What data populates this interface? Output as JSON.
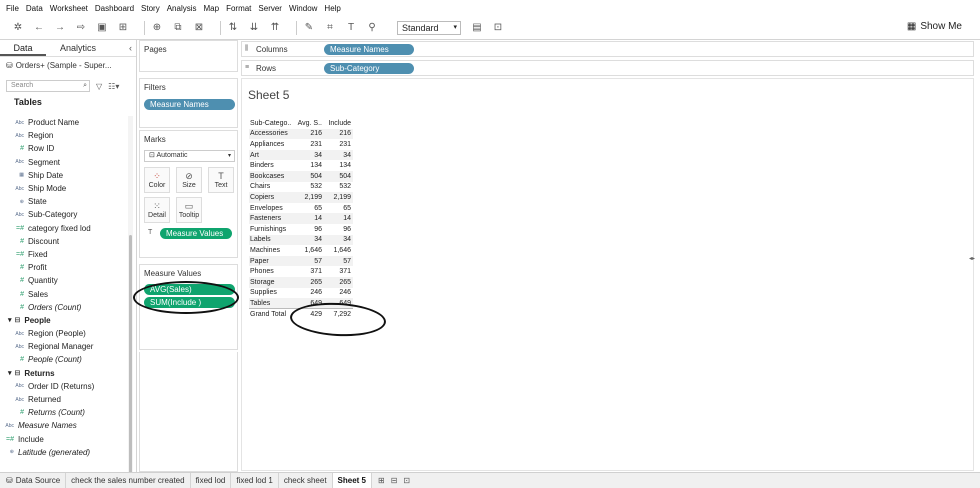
{
  "menu": [
    "File",
    "Data",
    "Worksheet",
    "Dashboard",
    "Story",
    "Analysis",
    "Map",
    "Format",
    "Server",
    "Window",
    "Help"
  ],
  "toolbar": {
    "fit_select": "Standard",
    "show_me": "Show Me"
  },
  "data_pane": {
    "tab_data": "Data",
    "tab_analytics": "Analytics",
    "datasource": "Orders+ (Sample - Super...",
    "search_placeholder": "Search",
    "tables_header": "Tables",
    "fields": [
      {
        "label": "Product Name",
        "type": "Abc",
        "kind": "dim",
        "italic": false
      },
      {
        "label": "Region",
        "type": "Abc",
        "kind": "dim",
        "italic": false
      },
      {
        "label": "Row ID",
        "type": "#",
        "kind": "dim",
        "italic": false
      },
      {
        "label": "Segment",
        "type": "Abc",
        "kind": "dim",
        "italic": false
      },
      {
        "label": "Ship Date",
        "type": "date",
        "kind": "dim",
        "italic": false
      },
      {
        "label": "Ship Mode",
        "type": "Abc",
        "kind": "dim",
        "italic": false
      },
      {
        "label": "State",
        "type": "geo",
        "kind": "dim",
        "italic": false
      },
      {
        "label": "Sub-Category",
        "type": "Abc",
        "kind": "dim",
        "italic": false
      },
      {
        "label": "category fixed lod",
        "type": "=#",
        "kind": "measure",
        "italic": false
      },
      {
        "label": "Discount",
        "type": "#",
        "kind": "measure",
        "italic": false
      },
      {
        "label": "Fixed",
        "type": "=#",
        "kind": "measure",
        "italic": false
      },
      {
        "label": "Profit",
        "type": "#",
        "kind": "measure",
        "italic": false
      },
      {
        "label": "Quantity",
        "type": "#",
        "kind": "measure",
        "italic": false
      },
      {
        "label": "Sales",
        "type": "#",
        "kind": "measure",
        "italic": false
      },
      {
        "label": "Orders (Count)",
        "type": "#",
        "kind": "measure",
        "italic": true
      }
    ],
    "groups": [
      {
        "label": "People",
        "fields": [
          {
            "label": "Region (People)",
            "type": "Abc",
            "italic": false
          },
          {
            "label": "Regional Manager",
            "type": "Abc",
            "italic": false
          },
          {
            "label": "People (Count)",
            "type": "#",
            "italic": true
          }
        ]
      },
      {
        "label": "Returns",
        "fields": [
          {
            "label": "Order ID (Returns)",
            "type": "Abc",
            "italic": false
          },
          {
            "label": "Returned",
            "type": "Abc",
            "italic": false
          },
          {
            "label": "Returns (Count)",
            "type": "#",
            "italic": true
          }
        ]
      }
    ],
    "extra_fields": [
      {
        "label": "Measure Names",
        "type": "Abc",
        "italic": true
      },
      {
        "label": "Include",
        "type": "=#",
        "italic": false
      },
      {
        "label": "Latitude (generated)",
        "type": "geo",
        "italic": true
      }
    ]
  },
  "cards": {
    "pages": "Pages",
    "filters": "Filters",
    "filter_pill": "Measure Names",
    "marks": "Marks",
    "mark_type": "Automatic",
    "mark_buttons": [
      "Color",
      "Size",
      "Text",
      "Detail",
      "Tooltip"
    ],
    "marks_pill": "Measure Values",
    "measure_values": "Measure Values",
    "mv_pills": [
      "AVG(Sales)",
      "SUM(Include )"
    ]
  },
  "shelves": {
    "columns_label": "Columns",
    "columns_pill": "Measure Names",
    "rows_label": "Rows",
    "rows_pill": "Sub-Category"
  },
  "sheet": {
    "title": "Sheet 5",
    "headers": [
      "Sub-Catego..",
      "Avg. S..",
      "Include"
    ],
    "rows": [
      [
        "Accessories",
        "216",
        "216"
      ],
      [
        "Appliances",
        "231",
        "231"
      ],
      [
        "Art",
        "34",
        "34"
      ],
      [
        "Binders",
        "134",
        "134"
      ],
      [
        "Bookcases",
        "504",
        "504"
      ],
      [
        "Chairs",
        "532",
        "532"
      ],
      [
        "Copiers",
        "2,199",
        "2,199"
      ],
      [
        "Envelopes",
        "65",
        "65"
      ],
      [
        "Fasteners",
        "14",
        "14"
      ],
      [
        "Furnishings",
        "96",
        "96"
      ],
      [
        "Labels",
        "34",
        "34"
      ],
      [
        "Machines",
        "1,646",
        "1,646"
      ],
      [
        "Paper",
        "57",
        "57"
      ],
      [
        "Phones",
        "371",
        "371"
      ],
      [
        "Storage",
        "265",
        "265"
      ],
      [
        "Supplies",
        "246",
        "246"
      ],
      [
        "Tables",
        "649",
        "649"
      ]
    ],
    "grand_total": [
      "Grand Total",
      "429",
      "7,292"
    ]
  },
  "bottom_tabs": {
    "data_source": "Data Source",
    "sheets": [
      "check the sales number created",
      "fixed lod",
      "fixed lod 1",
      "check sheet",
      "Sheet 5"
    ],
    "active": "Sheet 5"
  },
  "colors": {
    "dimension_pill": "#4e8fb0",
    "measure_pill": "#0fa46e",
    "annotation": "#111111"
  }
}
